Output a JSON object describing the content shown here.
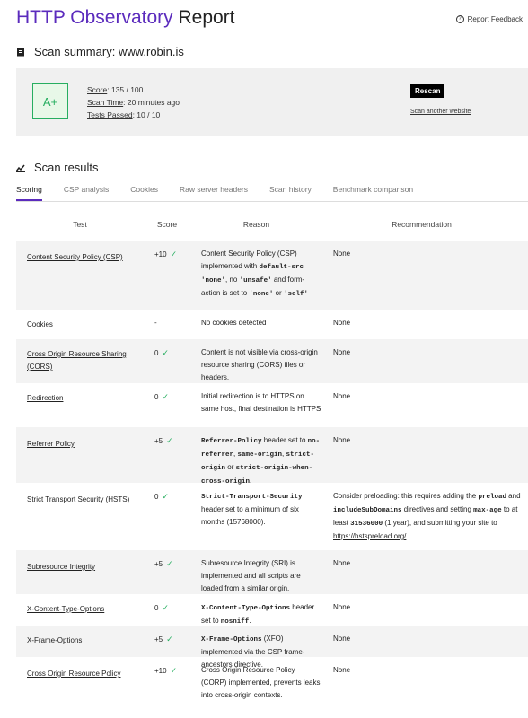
{
  "header": {
    "title_brand": "HTTP Observatory",
    "title_rest": " Report",
    "feedback": "Report Feedback"
  },
  "summary": {
    "label": "Scan summary:",
    "site": "www.robin.is",
    "grade": "A+",
    "score_k": "Score",
    "score_v": ": 135 / 100",
    "time_k": "Scan Time",
    "time_v": ": 20 minutes ago",
    "tests_k": "Tests Passed",
    "tests_v": ": 10 / 10",
    "rescan": "Rescan",
    "another": "Scan another website"
  },
  "results": {
    "title": "Scan results",
    "tabs": [
      "Scoring",
      "CSP analysis",
      "Cookies",
      "Raw server headers",
      "Scan history",
      "Benchmark comparison"
    ],
    "headers": [
      "Test",
      "Score",
      "Reason",
      "Recommendation"
    ]
  },
  "rows": [
    {
      "test": "Content Security Policy (CSP)",
      "score": "+10",
      "pass": true,
      "reason_html": "Content Security Policy (CSP) implemented with <code>default-src 'none'</code>, no <code>'unsafe'</code> and form-action is set to <code>'none'</code> or <code>'self'</code>",
      "rec_html": "None"
    },
    {
      "test": "Cookies",
      "score": "-",
      "pass": false,
      "reason_html": "No cookies detected",
      "rec_html": "None"
    },
    {
      "test": "Cross Origin Resource Sharing (CORS)",
      "score": "0",
      "pass": true,
      "reason_html": "Content is not visible via cross-origin resource sharing (CORS) files or headers.",
      "rec_html": "None"
    },
    {
      "test": "Redirection",
      "score": "0",
      "pass": true,
      "reason_html": "Initial redirection is to HTTPS on same host, final destination is HTTPS",
      "rec_html": "None"
    },
    {
      "test": "Referrer Policy",
      "score": "+5",
      "pass": true,
      "reason_html": "<code>Referrer-Policy</code> header set to <code>no-referrer</code>, <code>same-origin</code>, <code>strict-origin</code> or <code>strict-origin-when-cross-origin</code>.",
      "rec_html": "None"
    },
    {
      "test": "Strict Transport Security (HSTS)",
      "score": "0",
      "pass": true,
      "reason_html": "<code>Strict-Transport-Security</code> header set to a minimum of six months (15768000).",
      "rec_html": "Consider preloading: this requires adding the <code>preload</code> and <code>includeSubDomains</code> directives and setting <code>max-age</code> to at least <code>31536000</code> (1 year), and submitting your site to <a class=\"link\" href=\"#\">https://hstspreload.org/</a>."
    },
    {
      "test": "Subresource Integrity",
      "score": "+5",
      "pass": true,
      "reason_html": "Subresource Integrity (SRI) is implemented and all scripts are loaded from a similar origin.",
      "rec_html": "None"
    },
    {
      "test": "X-Content-Type-Options",
      "score": "0",
      "pass": true,
      "reason_html": "<code>X-Content-Type-Options</code> header set to <code>nosniff</code>.",
      "rec_html": "None"
    },
    {
      "test": "X-Frame-Options",
      "score": "+5",
      "pass": true,
      "reason_html": "<code>X-Frame-Options</code> (XFO) implemented via the CSP frame-ancestors directive.",
      "rec_html": "None"
    },
    {
      "test": "Cross Origin Resource Policy",
      "score": "+10",
      "pass": true,
      "reason_html": "Cross Origin Resource Policy (CORP) implemented, prevents leaks into cross-origin contexts.",
      "rec_html": "None"
    }
  ]
}
